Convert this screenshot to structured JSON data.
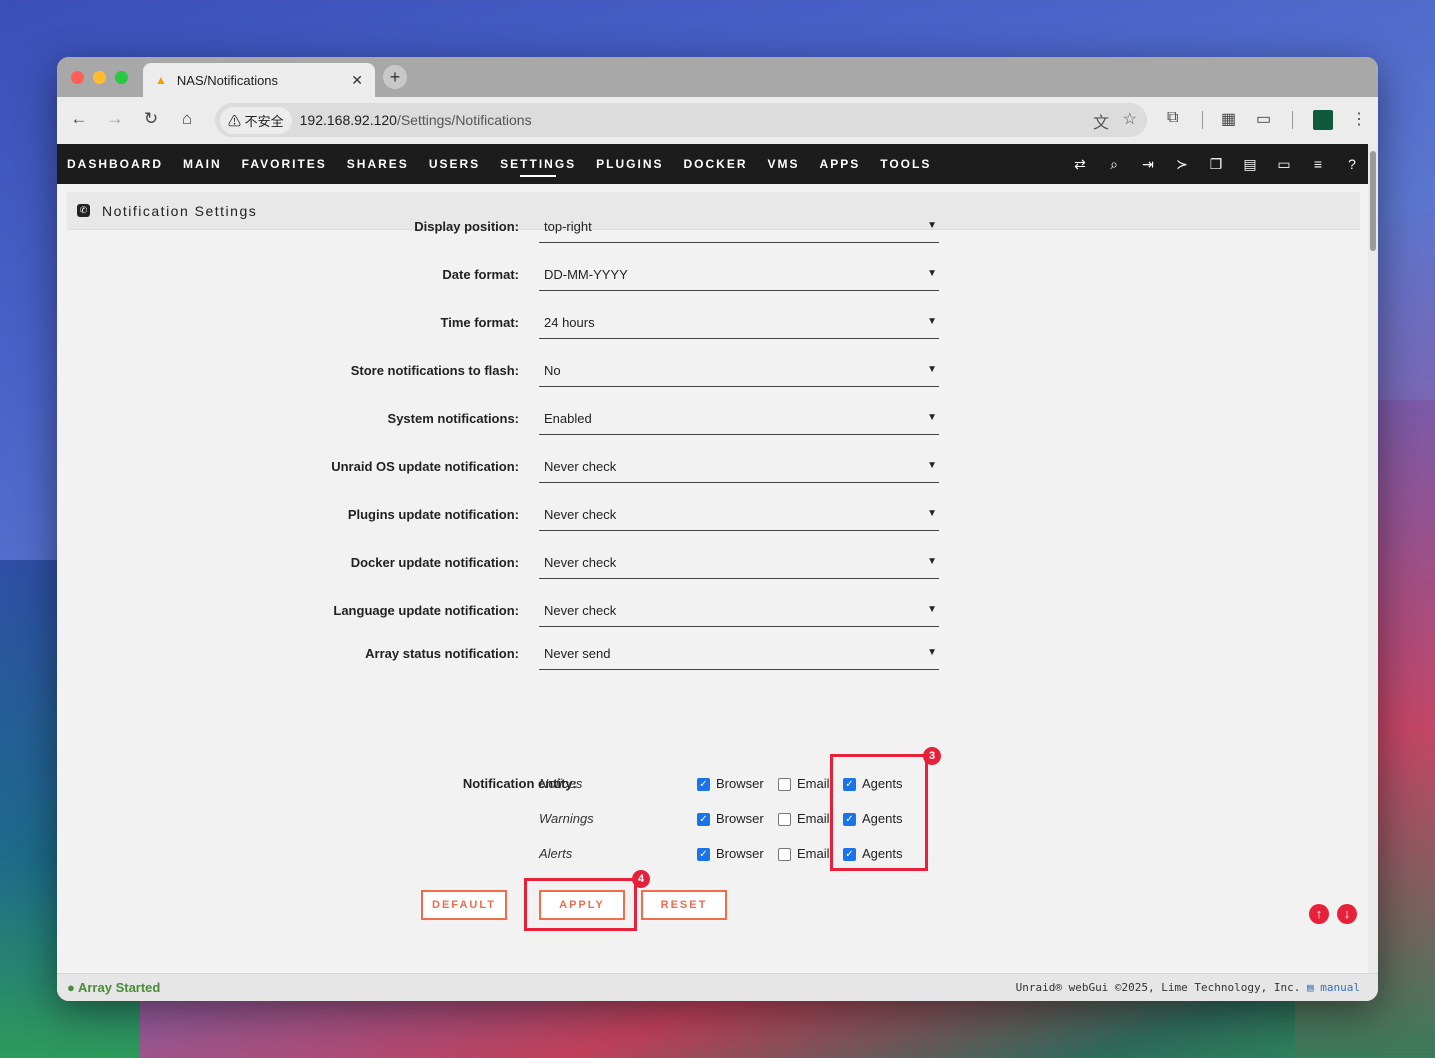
{
  "browser": {
    "tab_title": "NAS/Notifications",
    "tab_close": "✕",
    "new_tab": "+",
    "insecure_label": "⚠ 不安全",
    "url_host": "192.168.92.120",
    "url_path": "/Settings/Notifications"
  },
  "nav": {
    "items": [
      "DASHBOARD",
      "MAIN",
      "FAVORITES",
      "SHARES",
      "USERS",
      "SETTINGS",
      "PLUGINS",
      "DOCKER",
      "VMS",
      "APPS",
      "TOOLS"
    ],
    "active": "SETTINGS"
  },
  "section": {
    "title": "Notification Settings"
  },
  "settings": [
    {
      "label": "Display position:",
      "value": "top-right"
    },
    {
      "label": "Date format:",
      "value": "DD-MM-YYYY"
    },
    {
      "label": "Time format:",
      "value": "24 hours"
    },
    {
      "label": "Store notifications to flash:",
      "value": "No"
    },
    {
      "label": "System notifications:",
      "value": "Enabled"
    },
    {
      "label": "Unraid OS update notification:",
      "value": "Never check"
    },
    {
      "label": "Plugins update notification:",
      "value": "Never check"
    },
    {
      "label": "Docker update notification:",
      "value": "Never check"
    },
    {
      "label": "Language update notification:",
      "value": "Never check"
    },
    {
      "label": "Array status notification:",
      "value": "Never send"
    }
  ],
  "entity": {
    "label": "Notification entity:",
    "rows": [
      {
        "name": "Notices",
        "browser": true,
        "email": false,
        "agents": true
      },
      {
        "name": "Warnings",
        "browser": true,
        "email": false,
        "agents": true
      },
      {
        "name": "Alerts",
        "browser": true,
        "email": false,
        "agents": true
      }
    ],
    "browser_label": "Browser",
    "email_label": "Email",
    "agents_label": "Agents"
  },
  "annotations": {
    "badge_agents": "3",
    "badge_apply": "4",
    "color": "#e8213a"
  },
  "buttons": {
    "default": "DEFAULT",
    "apply": "APPLY",
    "reset": "RESET"
  },
  "footer": {
    "status": "Array Started",
    "copyright": "Unraid® webGui ©2025, Lime Technology, Inc.",
    "manual": "manual"
  }
}
